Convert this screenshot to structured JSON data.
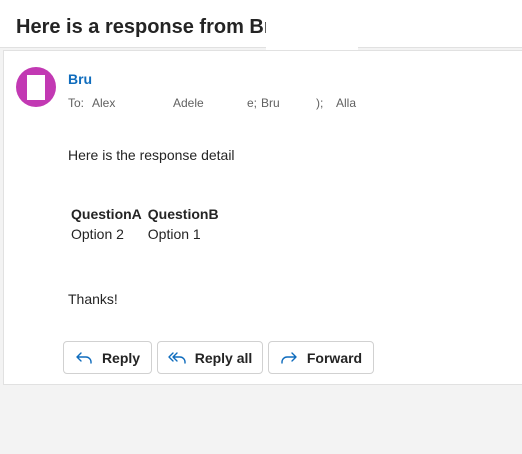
{
  "subject": "Here is a response from Bru",
  "sender": {
    "name": "Bru"
  },
  "recipients": {
    "prefix": "To:",
    "items": [
      "Alex",
      "Adele",
      "e;",
      "Bru",
      ");",
      "Alla"
    ]
  },
  "body": {
    "intro": "Here is the response detail",
    "table": {
      "headers": [
        "QuestionA",
        "QuestionB"
      ],
      "rows": [
        [
          "Option 2",
          "Option 1"
        ]
      ]
    },
    "closing": "Thanks!"
  },
  "actions": {
    "reply": "Reply",
    "reply_all": "Reply all",
    "forward": "Forward"
  },
  "colors": {
    "avatar": "#c239b3",
    "sender": "#0f6cbd",
    "icon": "#0f6cbd"
  }
}
